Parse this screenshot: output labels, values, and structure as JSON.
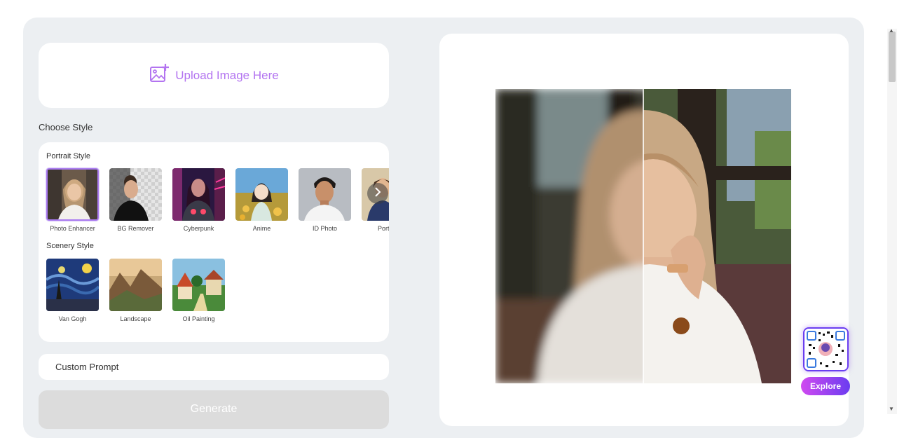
{
  "upload": {
    "label": "Upload Image Here"
  },
  "choose_style_label": "Choose Style",
  "portrait_style": {
    "title": "Portrait Style",
    "items": [
      {
        "label": "Photo Enhancer",
        "selected": true
      },
      {
        "label": "BG Remover"
      },
      {
        "label": "Cyberpunk"
      },
      {
        "label": "Anime"
      },
      {
        "label": "ID Photo"
      },
      {
        "label": "Portrait"
      }
    ]
  },
  "scenery_style": {
    "title": "Scenery Style",
    "items": [
      {
        "label": "Van Gogh"
      },
      {
        "label": "Landscape"
      },
      {
        "label": "Oil Painting"
      }
    ]
  },
  "custom_prompt": {
    "placeholder": "Custom Prompt"
  },
  "generate": {
    "label": "Generate"
  },
  "explore": {
    "label": "Explore"
  },
  "colors": {
    "accent": "#b374f0",
    "panel_bg": "#eceff2",
    "generate_bg": "#dcdcdc"
  }
}
